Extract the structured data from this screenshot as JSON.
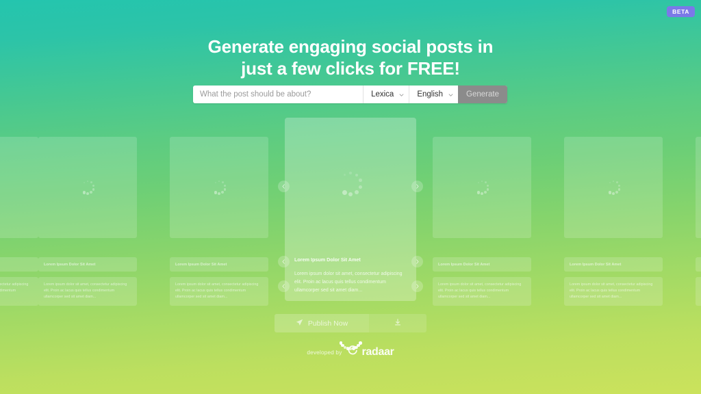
{
  "badge": {
    "label": "BETA",
    "color": "#7b79e8"
  },
  "headline": {
    "line1": "Generate engaging social posts in",
    "line2": "just a few clicks for FREE!"
  },
  "search": {
    "placeholder": "What the post should be about?",
    "value": "",
    "source_select": {
      "value": "Lexica",
      "icon": "chevron-down-icon"
    },
    "language_select": {
      "value": "English",
      "icon": "chevron-down-icon"
    },
    "generate_label": "Generate",
    "generate_color": "#8b8b8b"
  },
  "carousel": {
    "prev_icon": "chevron-left-icon",
    "next_icon": "chevron-right-icon",
    "card": {
      "title": "Lorem Ipsum Dolor Sit Amet",
      "body": "Lorem ipsum dolor sit amet, consectetur adipiscing elit. Proin ac lacus quis tellus condimentum ullamcorper sed sit amet diam...",
      "image_state": "loading"
    }
  },
  "actions": {
    "publish_label": "Publish Now",
    "publish_icon": "send-icon",
    "download_icon": "download-icon"
  },
  "footer": {
    "text": "developed by",
    "brand": "radaar",
    "brand_icon": "radaar-logo-icon"
  },
  "theme": {
    "gradient_top": "#24c5ae",
    "gradient_mid": "#6dcf76",
    "gradient_bottom": "#cbe25c"
  }
}
